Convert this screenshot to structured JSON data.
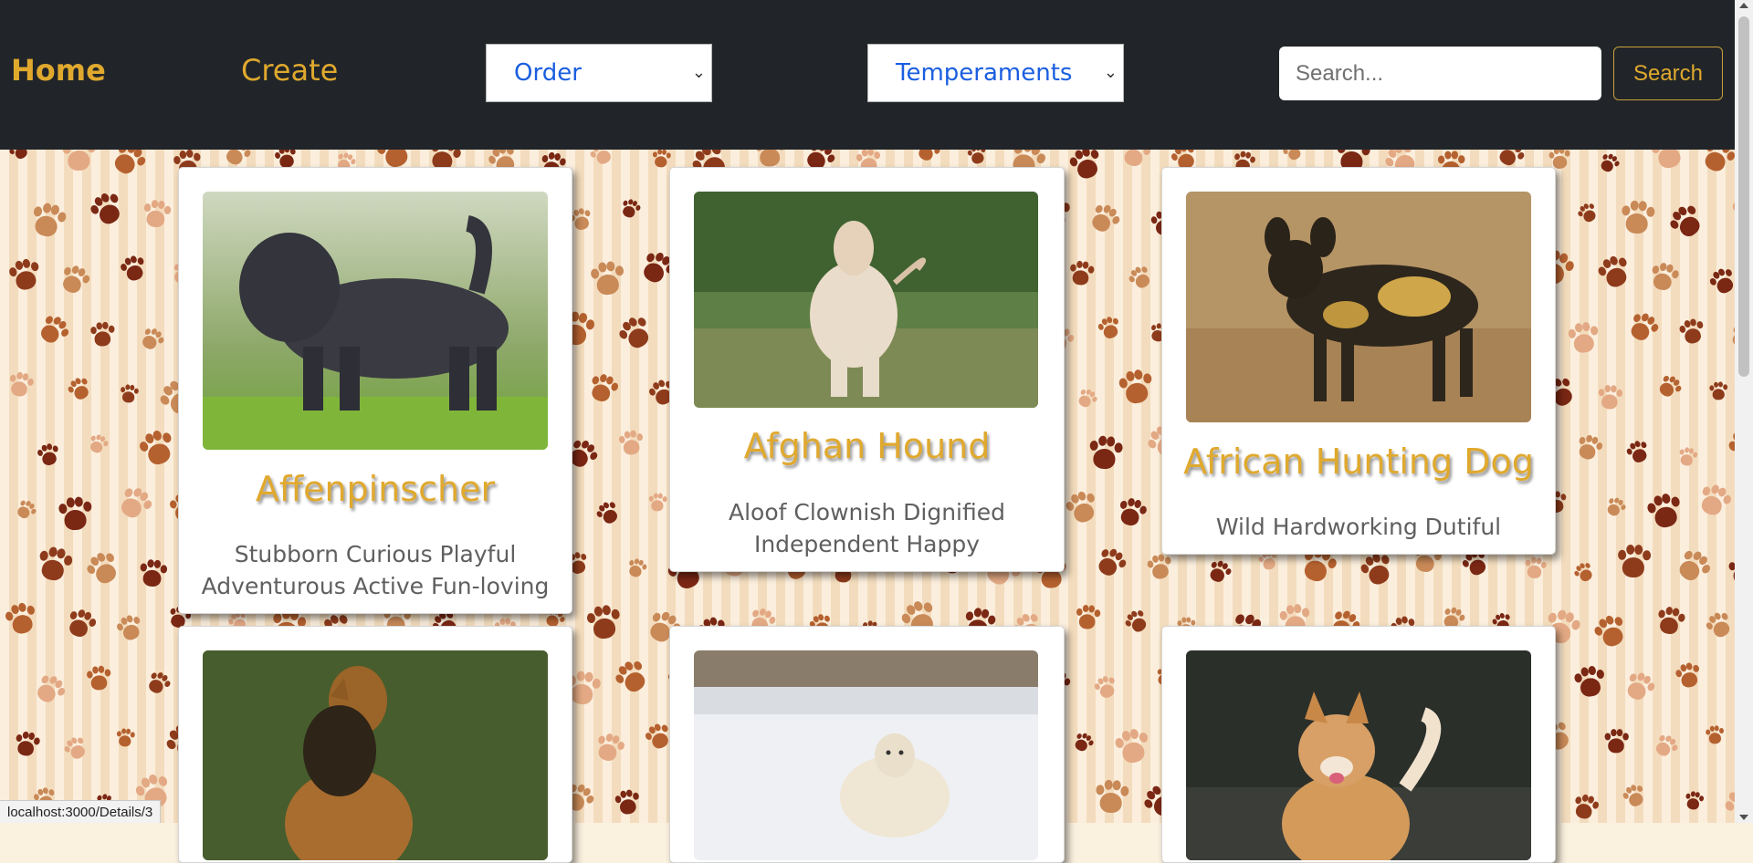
{
  "nav": {
    "home_label": "Home",
    "create_label": "Create",
    "order_select": "Order",
    "temperaments_select": "Temperaments",
    "search_placeholder": "Search...",
    "search_button": "Search"
  },
  "cards": [
    {
      "name": "Affenpinscher",
      "temperaments": "Stubborn Curious Playful Adventurous Active Fun-loving"
    },
    {
      "name": "Afghan Hound",
      "temperaments": "Aloof Clownish Dignified Independent Happy"
    },
    {
      "name": "African Hunting Dog",
      "temperaments": "Wild Hardworking Dutiful"
    },
    {
      "name": "",
      "temperaments": ""
    },
    {
      "name": "",
      "temperaments": ""
    },
    {
      "name": "",
      "temperaments": ""
    }
  ],
  "status_bar": {
    "url": "localhost:3000/Details/3"
  },
  "colors": {
    "navbar_bg": "#212529",
    "accent_gold": "#e0a92e",
    "select_text": "#1a5ee0"
  },
  "icons": {
    "select_chevron": "chevron-down-icon"
  }
}
